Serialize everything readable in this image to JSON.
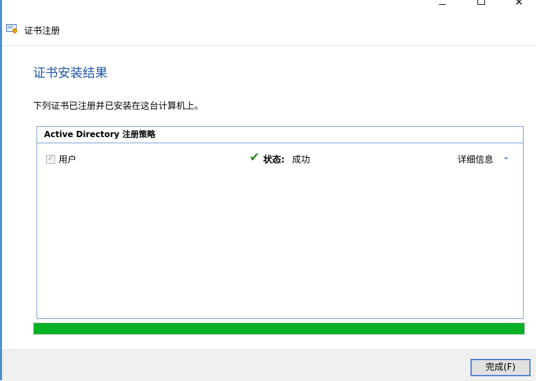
{
  "window": {
    "title": "证书注册",
    "controls": {
      "minimize_icon": "minimize-icon",
      "maximize_icon": "maximize-icon",
      "close_icon": "close-icon"
    }
  },
  "main": {
    "heading": "证书安装结果",
    "description": "下列证书已注册并已安装在这台计算机上。",
    "policy": {
      "header": "Active Directory 注册策略",
      "rows": [
        {
          "checked": true,
          "name": "用户",
          "status_label": "状态:",
          "status_value": "成功",
          "details_label": "详细信息"
        }
      ]
    },
    "progress": {
      "percent": 100,
      "color": "#06b025"
    }
  },
  "footer": {
    "finish_label": "完成(F)"
  },
  "colors": {
    "accent": "#1e55a5",
    "border": "#7aa3d7",
    "success": "#2f8a1e"
  }
}
